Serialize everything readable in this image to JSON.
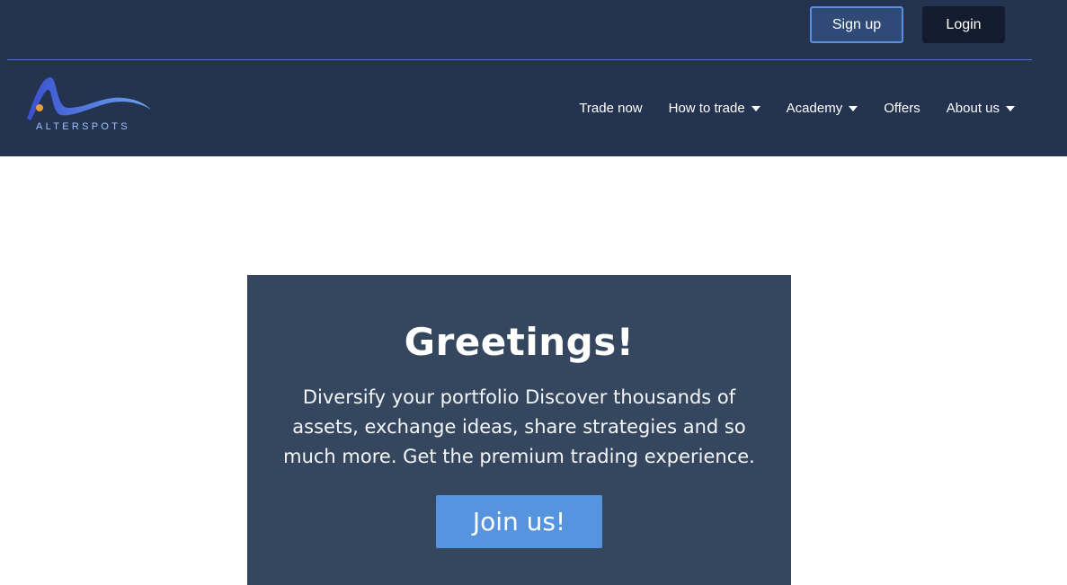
{
  "header": {
    "signup_label": "Sign up",
    "login_label": "Login",
    "logo_text": "ALTERSPOTS",
    "nav": [
      {
        "label": "Trade now",
        "has_dropdown": false
      },
      {
        "label": "How to trade",
        "has_dropdown": true
      },
      {
        "label": "Academy",
        "has_dropdown": true
      },
      {
        "label": "Offers",
        "has_dropdown": false
      },
      {
        "label": "About us",
        "has_dropdown": true
      }
    ]
  },
  "hero": {
    "title": "Greetings!",
    "description": "Diversify your portfolio Discover thousands of assets, exchange ideas, share strategies and so much more. Get the premium trading experience.",
    "cta_label": "Join us!"
  },
  "colors": {
    "header_bg": "#233350",
    "card_bg": "#35465f",
    "accent": "#5794e0",
    "login_bg": "#131c2e",
    "logo_dot": "#e8a03a"
  },
  "icons": {
    "nav_dropdown": "caret-down-icon",
    "logo": "alterspots-wave-logo"
  }
}
